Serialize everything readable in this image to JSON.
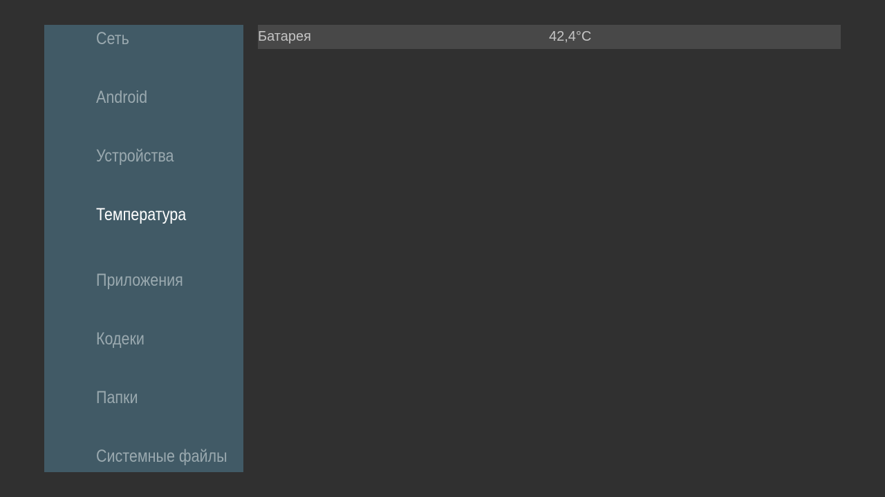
{
  "sidebar": {
    "items": [
      {
        "label": "Сеть"
      },
      {
        "label": "Android"
      },
      {
        "label": "Устройства"
      },
      {
        "label": "Температура"
      },
      {
        "label": "Приложения"
      },
      {
        "label": "Кодеки"
      },
      {
        "label": "Папки"
      },
      {
        "label": "Системные файлы"
      }
    ]
  },
  "main": {
    "rows": [
      {
        "label": "Батарея",
        "value": "42,4°C"
      }
    ]
  },
  "colors": {
    "background": "#303030",
    "sidebar_bg": "#415a66",
    "nav_text": "#9aa9af",
    "nav_active": "#ffffff",
    "row_bg": "#484848",
    "row_text": "#c4c4c4"
  }
}
